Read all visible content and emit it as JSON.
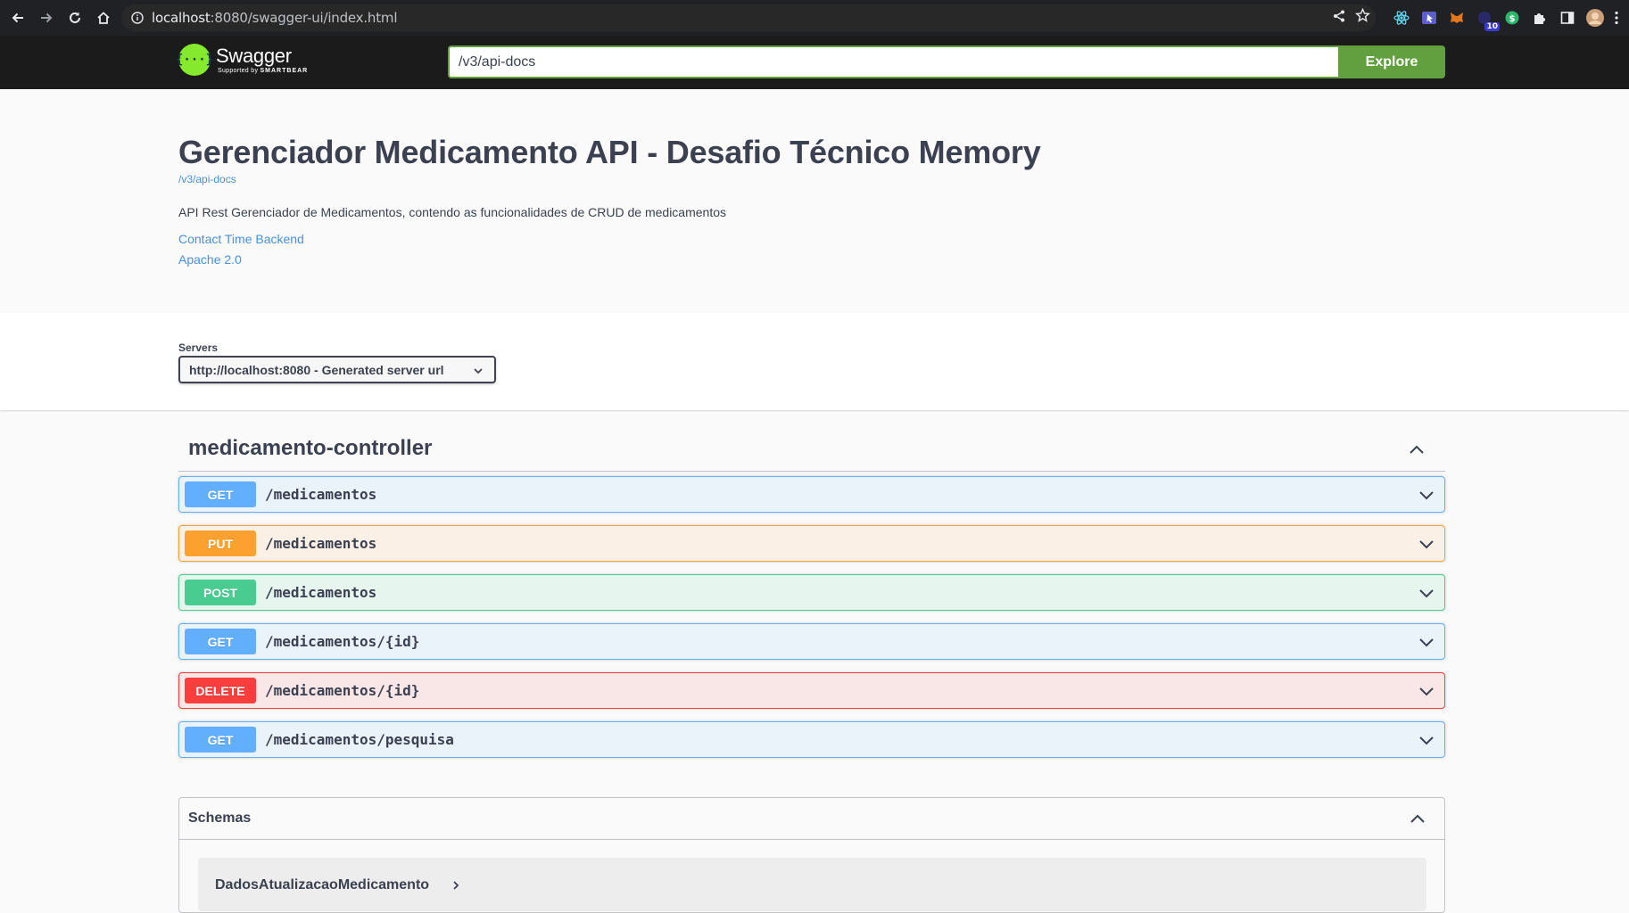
{
  "browser": {
    "url_host": "localhost",
    "url_rest": ":8080/swagger-ui/index.html",
    "extension_badge": "10"
  },
  "topbar": {
    "logo_title": "Swagger",
    "logo_sub_prefix": "Supported by ",
    "logo_sub_brand": "SMARTBEAR",
    "search_value": "/v3/api-docs",
    "explore_label": "Explore"
  },
  "info": {
    "title": "Gerenciador Medicamento API - Desafio Técnico Memory",
    "spec_url": "/v3/api-docs",
    "description": "API Rest Gerenciador de Medicamentos, contendo as funcionalidades de CRUD de medicamentos",
    "contact_link": "Contact Time Backend",
    "license_link": "Apache 2.0"
  },
  "servers": {
    "label": "Servers",
    "selected": "http://localhost:8080 - Generated server url"
  },
  "controller": {
    "name": "medicamento-controller",
    "operations": [
      {
        "method": "GET",
        "path": "/medicamentos"
      },
      {
        "method": "PUT",
        "path": "/medicamentos"
      },
      {
        "method": "POST",
        "path": "/medicamentos"
      },
      {
        "method": "GET",
        "path": "/medicamentos/{id}"
      },
      {
        "method": "DELETE",
        "path": "/medicamentos/{id}"
      },
      {
        "method": "GET",
        "path": "/medicamentos/pesquisa"
      }
    ]
  },
  "schemas": {
    "title": "Schemas",
    "models": [
      "DadosAtualizacaoMedicamento"
    ]
  },
  "colors": {
    "get": "#61affe",
    "put": "#fca130",
    "post": "#49cc90",
    "delete": "#f93e3e",
    "explore": "#62a03f",
    "link": "#4990e2"
  }
}
